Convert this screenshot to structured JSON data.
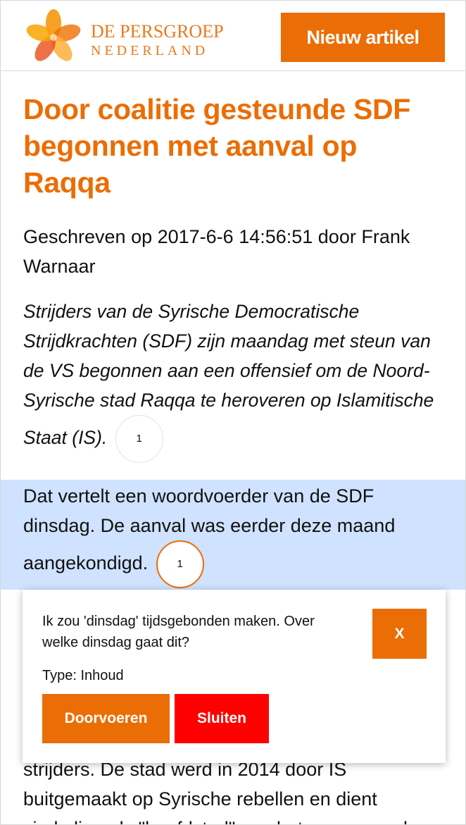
{
  "header": {
    "logo_line1": "DE PERSGROEP",
    "logo_line2": "NEDERLAND",
    "new_article_label": "Nieuw artikel"
  },
  "article": {
    "title": "Door coalitie gesteunde SDF begonnen met aanval op Raqqa",
    "meta": "Geschreven op 2017-6-6 14:56:51 door Frank Warnaar",
    "intro": "Strijders van de Syrische Democratische Strijdkrachten (SDF) zijn maandag met steun van de VS begonnen aan een offensief om de Noord-Syrische stad Raqqa te heroveren op Islamitische Staat (IS).",
    "intro_badge": "1",
    "para1": "Dat vertelt een woordvoerder van de SDF dinsdag. De aanval was eerder deze maand aangekondigd.",
    "para1_badge": "1",
    "para2": "strijders. De stad werd in 2014 door IS buitgemaakt op Syrische rebellen en dient sindsdien als \"hoofdstad\" van het zogenoemde"
  },
  "popup": {
    "message": "Ik zou 'dinsdag' tijdsgebonden maken. Over welke dinsdag gaat dit?",
    "type_text": "Type: Inhoud",
    "close_x_label": "X",
    "apply_label": "Doorvoeren",
    "close_label": "Sluiten"
  },
  "colors": {
    "accent": "#eb6d05",
    "danger": "#ff0000",
    "highlight": "#cfe2ff"
  }
}
